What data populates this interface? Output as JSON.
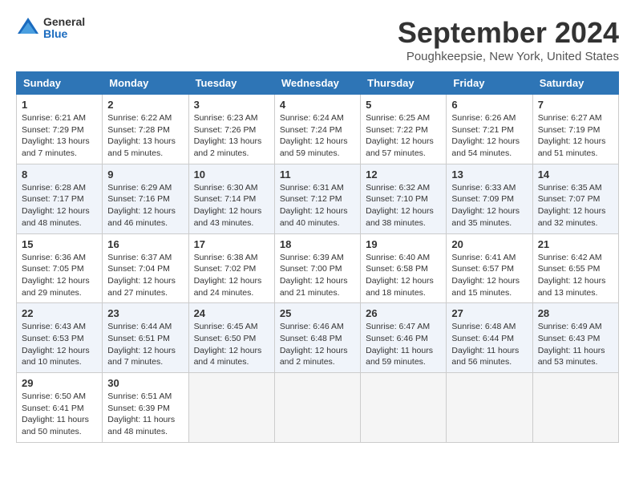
{
  "header": {
    "logo_line1": "General",
    "logo_line2": "Blue",
    "month_title": "September 2024",
    "location": "Poughkeepsie, New York, United States"
  },
  "days_of_week": [
    "Sunday",
    "Monday",
    "Tuesday",
    "Wednesday",
    "Thursday",
    "Friday",
    "Saturday"
  ],
  "weeks": [
    [
      {
        "day": "1",
        "sunrise": "Sunrise: 6:21 AM",
        "sunset": "Sunset: 7:29 PM",
        "daylight": "Daylight: 13 hours and 7 minutes."
      },
      {
        "day": "2",
        "sunrise": "Sunrise: 6:22 AM",
        "sunset": "Sunset: 7:28 PM",
        "daylight": "Daylight: 13 hours and 5 minutes."
      },
      {
        "day": "3",
        "sunrise": "Sunrise: 6:23 AM",
        "sunset": "Sunset: 7:26 PM",
        "daylight": "Daylight: 13 hours and 2 minutes."
      },
      {
        "day": "4",
        "sunrise": "Sunrise: 6:24 AM",
        "sunset": "Sunset: 7:24 PM",
        "daylight": "Daylight: 12 hours and 59 minutes."
      },
      {
        "day": "5",
        "sunrise": "Sunrise: 6:25 AM",
        "sunset": "Sunset: 7:22 PM",
        "daylight": "Daylight: 12 hours and 57 minutes."
      },
      {
        "day": "6",
        "sunrise": "Sunrise: 6:26 AM",
        "sunset": "Sunset: 7:21 PM",
        "daylight": "Daylight: 12 hours and 54 minutes."
      },
      {
        "day": "7",
        "sunrise": "Sunrise: 6:27 AM",
        "sunset": "Sunset: 7:19 PM",
        "daylight": "Daylight: 12 hours and 51 minutes."
      }
    ],
    [
      {
        "day": "8",
        "sunrise": "Sunrise: 6:28 AM",
        "sunset": "Sunset: 7:17 PM",
        "daylight": "Daylight: 12 hours and 48 minutes."
      },
      {
        "day": "9",
        "sunrise": "Sunrise: 6:29 AM",
        "sunset": "Sunset: 7:16 PM",
        "daylight": "Daylight: 12 hours and 46 minutes."
      },
      {
        "day": "10",
        "sunrise": "Sunrise: 6:30 AM",
        "sunset": "Sunset: 7:14 PM",
        "daylight": "Daylight: 12 hours and 43 minutes."
      },
      {
        "day": "11",
        "sunrise": "Sunrise: 6:31 AM",
        "sunset": "Sunset: 7:12 PM",
        "daylight": "Daylight: 12 hours and 40 minutes."
      },
      {
        "day": "12",
        "sunrise": "Sunrise: 6:32 AM",
        "sunset": "Sunset: 7:10 PM",
        "daylight": "Daylight: 12 hours and 38 minutes."
      },
      {
        "day": "13",
        "sunrise": "Sunrise: 6:33 AM",
        "sunset": "Sunset: 7:09 PM",
        "daylight": "Daylight: 12 hours and 35 minutes."
      },
      {
        "day": "14",
        "sunrise": "Sunrise: 6:35 AM",
        "sunset": "Sunset: 7:07 PM",
        "daylight": "Daylight: 12 hours and 32 minutes."
      }
    ],
    [
      {
        "day": "15",
        "sunrise": "Sunrise: 6:36 AM",
        "sunset": "Sunset: 7:05 PM",
        "daylight": "Daylight: 12 hours and 29 minutes."
      },
      {
        "day": "16",
        "sunrise": "Sunrise: 6:37 AM",
        "sunset": "Sunset: 7:04 PM",
        "daylight": "Daylight: 12 hours and 27 minutes."
      },
      {
        "day": "17",
        "sunrise": "Sunrise: 6:38 AM",
        "sunset": "Sunset: 7:02 PM",
        "daylight": "Daylight: 12 hours and 24 minutes."
      },
      {
        "day": "18",
        "sunrise": "Sunrise: 6:39 AM",
        "sunset": "Sunset: 7:00 PM",
        "daylight": "Daylight: 12 hours and 21 minutes."
      },
      {
        "day": "19",
        "sunrise": "Sunrise: 6:40 AM",
        "sunset": "Sunset: 6:58 PM",
        "daylight": "Daylight: 12 hours and 18 minutes."
      },
      {
        "day": "20",
        "sunrise": "Sunrise: 6:41 AM",
        "sunset": "Sunset: 6:57 PM",
        "daylight": "Daylight: 12 hours and 15 minutes."
      },
      {
        "day": "21",
        "sunrise": "Sunrise: 6:42 AM",
        "sunset": "Sunset: 6:55 PM",
        "daylight": "Daylight: 12 hours and 13 minutes."
      }
    ],
    [
      {
        "day": "22",
        "sunrise": "Sunrise: 6:43 AM",
        "sunset": "Sunset: 6:53 PM",
        "daylight": "Daylight: 12 hours and 10 minutes."
      },
      {
        "day": "23",
        "sunrise": "Sunrise: 6:44 AM",
        "sunset": "Sunset: 6:51 PM",
        "daylight": "Daylight: 12 hours and 7 minutes."
      },
      {
        "day": "24",
        "sunrise": "Sunrise: 6:45 AM",
        "sunset": "Sunset: 6:50 PM",
        "daylight": "Daylight: 12 hours and 4 minutes."
      },
      {
        "day": "25",
        "sunrise": "Sunrise: 6:46 AM",
        "sunset": "Sunset: 6:48 PM",
        "daylight": "Daylight: 12 hours and 2 minutes."
      },
      {
        "day": "26",
        "sunrise": "Sunrise: 6:47 AM",
        "sunset": "Sunset: 6:46 PM",
        "daylight": "Daylight: 11 hours and 59 minutes."
      },
      {
        "day": "27",
        "sunrise": "Sunrise: 6:48 AM",
        "sunset": "Sunset: 6:44 PM",
        "daylight": "Daylight: 11 hours and 56 minutes."
      },
      {
        "day": "28",
        "sunrise": "Sunrise: 6:49 AM",
        "sunset": "Sunset: 6:43 PM",
        "daylight": "Daylight: 11 hours and 53 minutes."
      }
    ],
    [
      {
        "day": "29",
        "sunrise": "Sunrise: 6:50 AM",
        "sunset": "Sunset: 6:41 PM",
        "daylight": "Daylight: 11 hours and 50 minutes."
      },
      {
        "day": "30",
        "sunrise": "Sunrise: 6:51 AM",
        "sunset": "Sunset: 6:39 PM",
        "daylight": "Daylight: 11 hours and 48 minutes."
      },
      null,
      null,
      null,
      null,
      null
    ]
  ]
}
